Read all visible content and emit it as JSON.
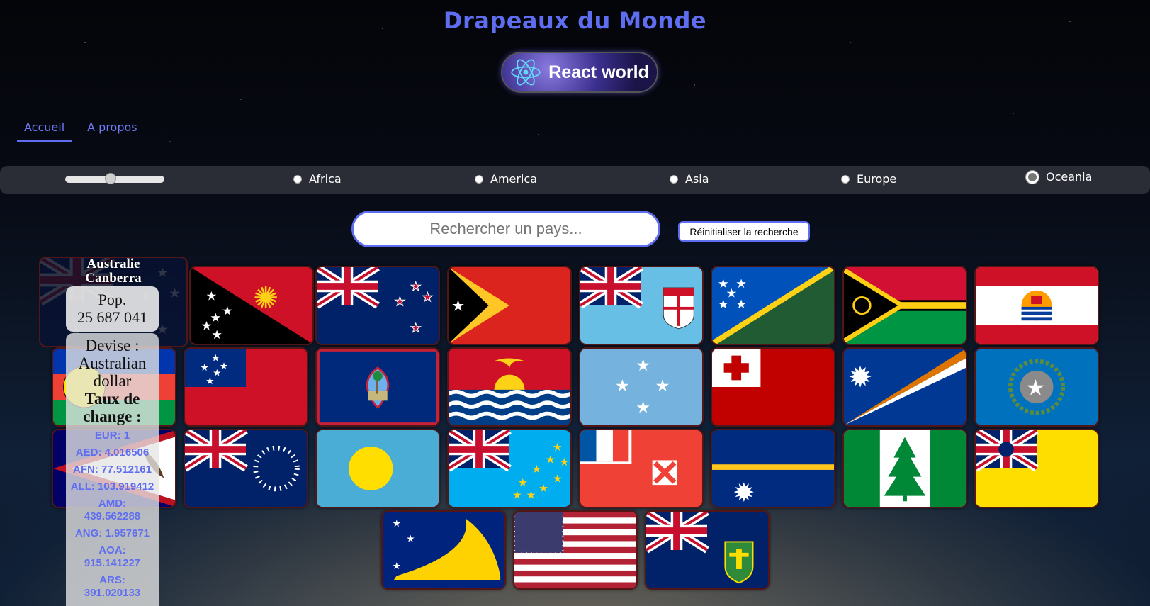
{
  "page": {
    "title": "Drapeaux du Monde"
  },
  "logo": {
    "text": "React world",
    "icon": "react-atom-icon"
  },
  "nav": {
    "home": "Accueil",
    "about": "A propos"
  },
  "filters": {
    "range_value": 0.45,
    "regions": [
      "Africa",
      "America",
      "Asia",
      "Europe",
      "Oceania"
    ],
    "selected": "Oceania"
  },
  "search": {
    "placeholder": "Rechercher un pays...",
    "value": "",
    "reset_label": "Réinitialiser la recherche"
  },
  "card": {
    "country": "Australie",
    "capital": "Canberra",
    "pop_label": "Pop.",
    "population": "25 687 041",
    "currency_label": "Devise :",
    "currency_name_1": "Australian",
    "currency_name_2": "dollar",
    "rate_label_1": "Taux de",
    "rate_label_2": "change :",
    "rates": [
      "EUR: 1",
      "AED: 4.016506",
      "AFN: 77.512161",
      "ALL: 103.919412",
      "AMD:",
      "439.562288",
      "ANG: 1.957671",
      "AOA:",
      "915.141227",
      "ARS:",
      "391.020133"
    ]
  },
  "flags": [
    "papua-new-guinea-flag",
    "new-zealand-flag",
    "timor-leste-flag",
    "fiji-flag",
    "solomon-islands-flag",
    "vanuatu-flag",
    "french-polynesia-flag",
    "new-caledonia-flag",
    "samoa-flag",
    "guam-flag",
    "kiribati-flag",
    "micronesia-flag",
    "tonga-flag",
    "marshall-islands-flag",
    "northern-mariana-islands-flag",
    "american-samoa-flag",
    "cook-islands-flag",
    "palau-flag",
    "tuvalu-flag",
    "wallis-futuna-flag",
    "nauru-flag",
    "norfolk-island-flag",
    "niue-flag",
    "tokelau-flag",
    "united-states-flag",
    "pitcairn-islands-flag"
  ],
  "colors": {
    "accent": "#5f6ef0",
    "bar": "#2a2d35",
    "card_border": "#531616"
  }
}
